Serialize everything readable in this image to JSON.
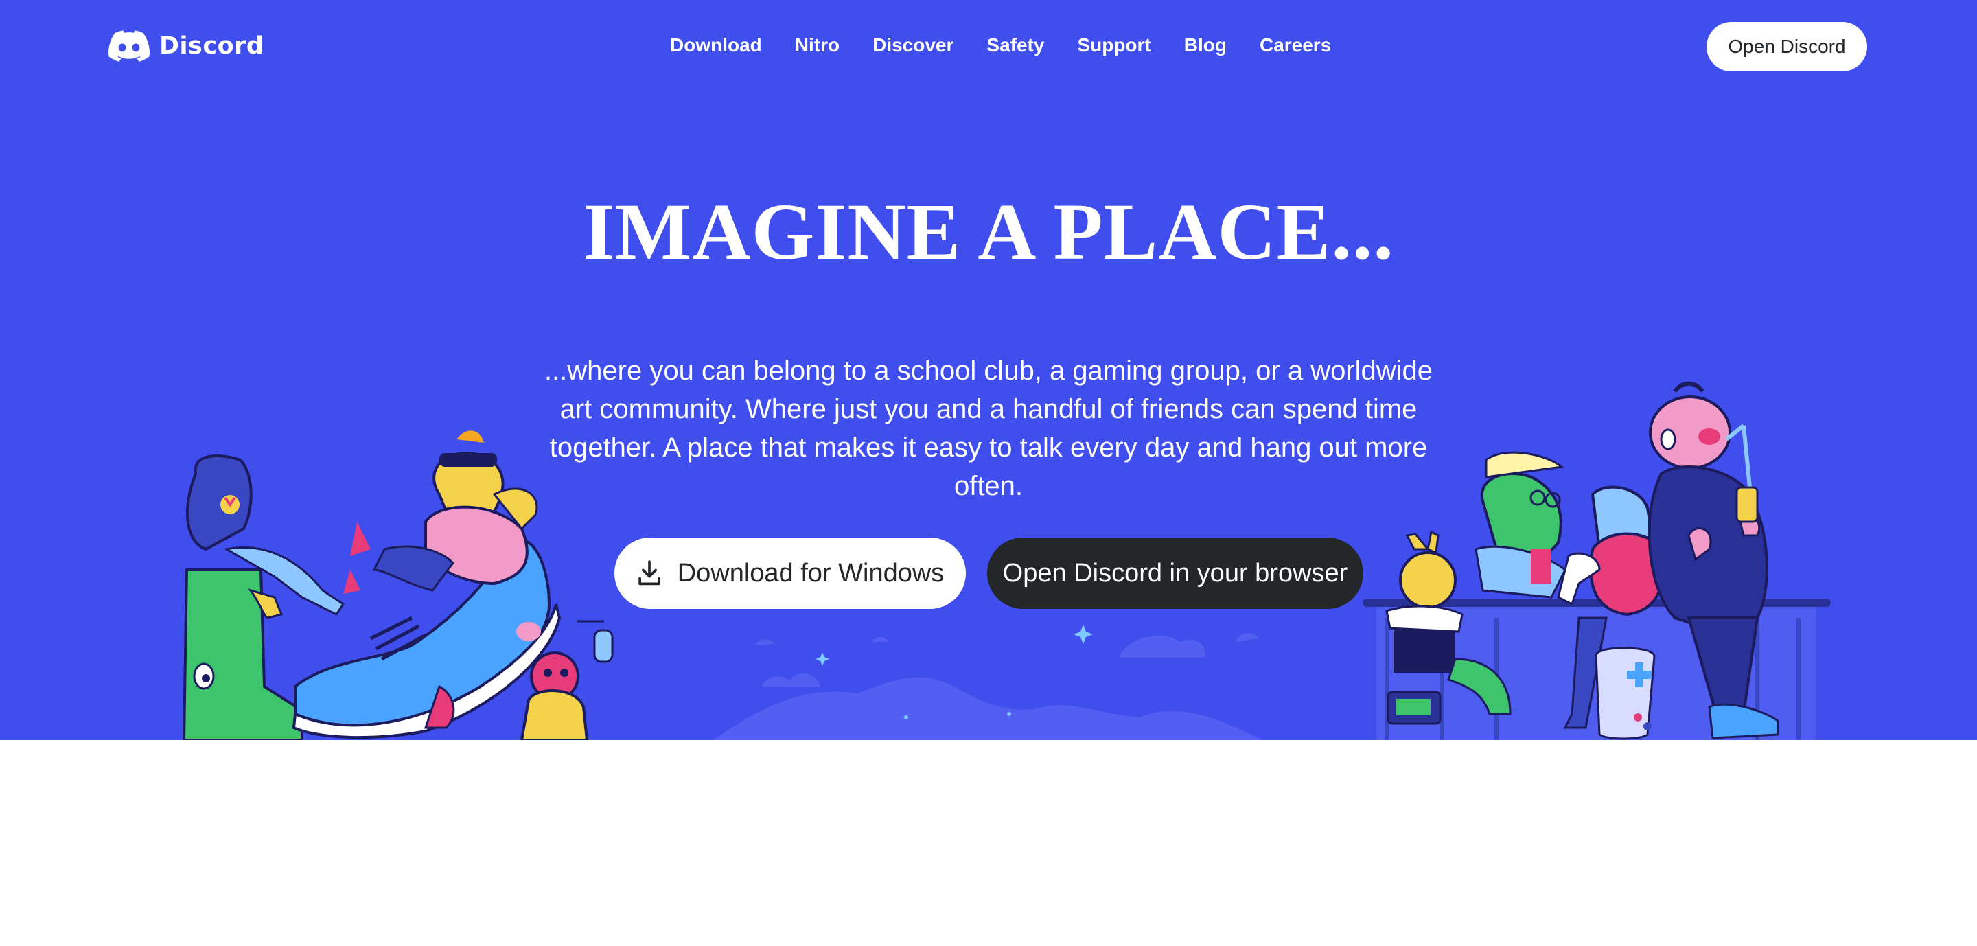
{
  "brand": {
    "name": "Discord"
  },
  "nav": {
    "links": [
      "Download",
      "Nitro",
      "Discover",
      "Safety",
      "Support",
      "Blog",
      "Careers"
    ],
    "open_button": "Open Discord"
  },
  "hero": {
    "title": "IMAGINE A PLACE...",
    "subtitle": "...where you can belong to a school club, a gaming group, or a worldwide art community. Where just you and a handful of friends can spend time together. A place that makes it easy to talk every day and hang out more often.",
    "download_button": "Download for Windows",
    "browser_button": "Open Discord in your browser"
  },
  "colors": {
    "blurple": "#404eed",
    "dark": "#23272a",
    "white": "#ffffff"
  },
  "icons": [
    "discord-logo-icon",
    "download-icon"
  ]
}
